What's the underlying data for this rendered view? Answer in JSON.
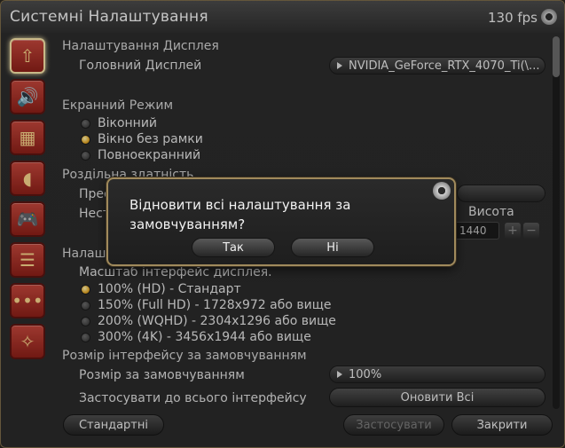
{
  "window": {
    "title": "Системні Налаштування",
    "fps": "130 fps"
  },
  "sidebar": {
    "items": [
      {
        "icon": "display-icon",
        "glyph": "⇧"
      },
      {
        "icon": "sound-icon",
        "glyph": "🔊"
      },
      {
        "icon": "graphics-icon",
        "glyph": "▦"
      },
      {
        "icon": "mouse-icon",
        "glyph": "◖"
      },
      {
        "icon": "gamepad-icon",
        "glyph": "🎮"
      },
      {
        "icon": "document-icon",
        "glyph": "☰"
      },
      {
        "icon": "more-icon",
        "glyph": "•••"
      },
      {
        "icon": "accessibility-icon",
        "glyph": "✧"
      }
    ]
  },
  "display": {
    "section_title": "Налаштування Дисплея",
    "main_display_label": "Головний Дисплей",
    "main_display_value": "NVIDIA_GeForce_RTX_4070_Ti(\\..."
  },
  "screen_mode": {
    "title": "Екранний Режим",
    "options": [
      "Віконний",
      "Вікно без рамки",
      "Повноекранний"
    ],
    "selected_index": 1
  },
  "resolution": {
    "title": "Роздільна здатність",
    "row1_label": "Прес",
    "row2_label": "Нест",
    "height_label": "Висота",
    "height_value": "1440",
    "plus": "+",
    "minus": "−"
  },
  "ui_scale": {
    "title": "Налаш",
    "subtitle": "Масштаб інтерфейс дисплея.",
    "options": [
      "100% (HD) - Стандарт",
      "150% (Full HD) - 1728x972 або вище",
      "200% (WQHD) - 2304x1296 або вище",
      "300% (4K) - 3456x1944 або вище"
    ],
    "selected_index": 0
  },
  "interface_size": {
    "title": "Розмір інтерфейсу за замовчуванням",
    "default_label": "Розмір за замовчуванням",
    "default_value": "100%",
    "apply_all_label": "Застосувати до всього інтерфейсу",
    "update_all_button": "Оновити Всі"
  },
  "footer": {
    "defaults_button": "Стандартні",
    "apply_button": "Застосувати",
    "close_button": "Закрити"
  },
  "dialog": {
    "message": "Відновити всі налаштування за замовчуванням?",
    "yes_button": "Так",
    "no_button": "Ні"
  },
  "colors": {
    "accent_gold": "#e0a526",
    "sidebar_red": "#a52a22",
    "dialog_border": "#a08a5c"
  }
}
